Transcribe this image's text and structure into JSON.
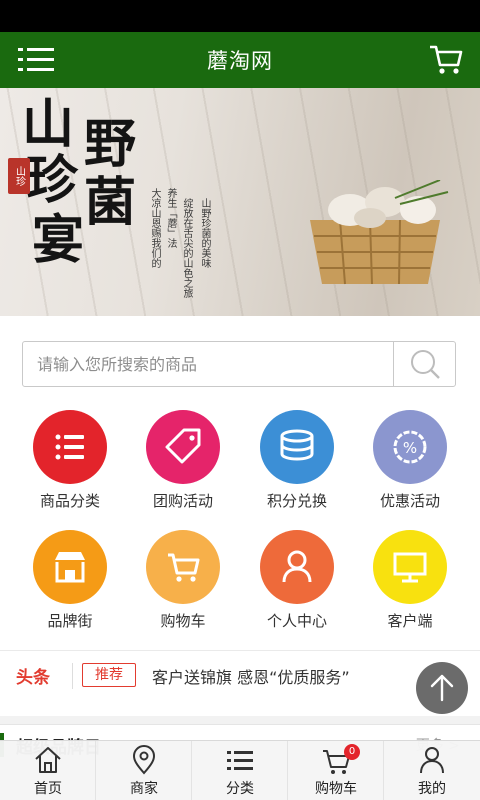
{
  "header": {
    "title": "蘑淘网"
  },
  "banner": {
    "calligraphy": [
      "山",
      "野",
      "珍",
      "菌",
      "宴"
    ],
    "seal": "山珍",
    "poem_lines": [
      "山野珍菌的美味",
      "绽放在舌尖的山色之旅",
      "养生「蘑」法",
      "大凉山恩赐我们的"
    ],
    "slides": 2,
    "active_slide": 2
  },
  "search": {
    "placeholder": "请输入您所搜索的商品",
    "value": ""
  },
  "categories": [
    {
      "label": "商品分类",
      "icon": "list-icon",
      "color": "#e3242b"
    },
    {
      "label": "团购活动",
      "icon": "tag-icon",
      "color": "#e5246a"
    },
    {
      "label": "积分兑换",
      "icon": "coins-icon",
      "color": "#3c8fd6"
    },
    {
      "label": "优惠活动",
      "icon": "discount-icon",
      "color": "#8b96cf"
    },
    {
      "label": "品牌街",
      "icon": "store-icon",
      "color": "#f59b16"
    },
    {
      "label": "购物车",
      "icon": "cart-icon",
      "color": "#f7b04a"
    },
    {
      "label": "个人中心",
      "icon": "user-icon",
      "color": "#ee6a3a"
    },
    {
      "label": "客户端",
      "icon": "monitor-icon",
      "color": "#f8e10f"
    }
  ],
  "news": {
    "head": "头条",
    "badge": "推荐",
    "text": "客户送锦旗 感恩“优质服务”"
  },
  "section": {
    "title": "超级品牌日",
    "more": "更多 >"
  },
  "tabbar": [
    {
      "label": "首页",
      "icon": "home-icon"
    },
    {
      "label": "商家",
      "icon": "location-pin-icon"
    },
    {
      "label": "分类",
      "icon": "list-icon"
    },
    {
      "label": "购物车",
      "icon": "cart-icon",
      "badge": "0"
    },
    {
      "label": "我的",
      "icon": "user-icon"
    }
  ],
  "colors": {
    "header": "#1a6a0f",
    "accent": "#e3242b"
  }
}
